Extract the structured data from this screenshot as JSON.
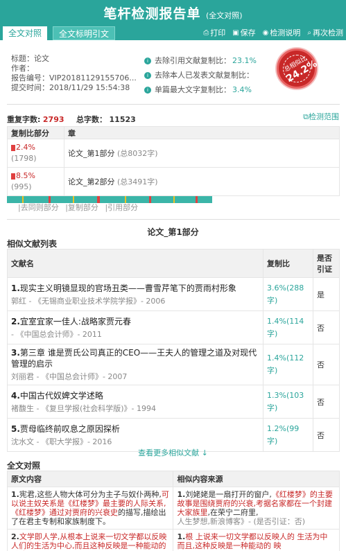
{
  "header": {
    "title": "笔杆检测报告单",
    "subtitle": "(全文对照)",
    "tabs": [
      {
        "label": "全文对照",
        "active": true
      },
      {
        "label": "全文标明引文",
        "active": false
      }
    ],
    "actions": [
      {
        "label": "打印",
        "icon": "printer-icon"
      },
      {
        "label": "保存",
        "icon": "save-icon"
      },
      {
        "label": "检测说明",
        "icon": "help-icon"
      },
      {
        "label": "再次检测",
        "icon": "search-icon"
      }
    ]
  },
  "info": {
    "title": "标题：论文",
    "author": "作者：",
    "report_no": "报告编号：VIP20181129155706...",
    "submit_time": "提交时间：2018/11/29 15:54:38"
  },
  "metrics": [
    {
      "label": "去除引用文献复制比：",
      "value": "23.1%"
    },
    {
      "label": "去除本人已发表文献复制比：",
      "value": ""
    },
    {
      "label": "单篇最大文字复制比：",
      "value": "3.4%"
    }
  ],
  "stamp": {
    "label": "总相似比",
    "value": "24.2%"
  },
  "counts": {
    "dup_label": "重复字数:",
    "dup_value": "2793",
    "total_label": "总字数：",
    "total_value": "11523",
    "range_link": "检测范围"
  },
  "parts": {
    "headers": [
      "复制比部分",
      "章"
    ],
    "rows": [
      {
        "pct": "2.4%",
        "count": "(1798)",
        "chapter": "论文_第1部分",
        "total": "(总8032字)"
      },
      {
        "pct": "8.5%",
        "count": "(995)",
        "chapter": "论文_第2部分",
        "total": "(总3491字)"
      }
    ]
  },
  "legend": [
    "|去同则部分",
    "|复制部分",
    "|引用部分"
  ],
  "section_title": "论文_第1部分",
  "similar_title": "相似文献列表",
  "docs": {
    "headers": [
      "文献名",
      "复制比",
      "是否引证"
    ],
    "rows": [
      {
        "num": "1.",
        "title": "现实主义明镜显现的官场丑类——曹雪芹笔下的贾雨村形象",
        "meta": "郭红 - 《无锡商业职业技术学院学报》- 2006",
        "ratio": "3.6%(288字)",
        "cite": "是"
      },
      {
        "num": "2.",
        "title": "宜室宜家一佳人:战略家贾元春",
        "meta": "- 《中国总会计师》- 2011",
        "ratio": "1.4%(114字)",
        "cite": "否"
      },
      {
        "num": "3.",
        "title": "第三章 谁是贾氏公司真正的CEO——王夫人的管理之道及对现代管理的启示",
        "meta": "刘丽君 - 《中国总会计师》- 2007",
        "ratio": "1.4%(112字)",
        "cite": "否"
      },
      {
        "num": "4.",
        "title": "中国古代奴婢文学述略",
        "meta": "褚馥生 - 《复旦学报(社会科学版)》- 1994",
        "ratio": "1.3%(103字)",
        "cite": "否"
      },
      {
        "num": "5.",
        "title": "贾母临终前叹息之原因探析",
        "meta": "沈水文 - 《职大学报》- 2016",
        "ratio": "1.2%(99字)",
        "cite": "否"
      }
    ]
  },
  "more_link": "查看更多相似文献 ↓",
  "fulltext": {
    "title": "全文对照",
    "headers": [
      "原文内容",
      "相似内容来源"
    ],
    "rows": [
      {
        "left_num": "1.",
        "left_normal_1": "宪君,这些人物大体可分为主子与奴仆两种,",
        "left_hl": "可以说主奴关系是《红楼梦》最主要的人际关系,《红楼梦》通过对贾府的兴衰史",
        "left_normal_2": "的描写,描绘出了在君主专制和家族制度下。",
        "right_num": "1.",
        "right_normal_1": "刘姥姥是一扇打开的窗户,",
        "right_hl": "《红楼梦》的主要故事是围绕贾府的兴衰,考据名家都在一个封建大家族里",
        "right_normal_2": ",在荣宁二府里,",
        "right_meta": "人生梦想,新浪博客》- (是否引证：否)"
      },
      {
        "left_num": "2.",
        "left_normal_1": "",
        "left_hl": "文学即人学,从根本上说来一切文学都以反映人们的生活为中心,而且这种反映是一种能动的反映",
        "left_normal_2": "",
        "right_num": "1.",
        "right_normal_1": "",
        "right_hl": "根 上说来一切文学都以反映人的 生活为中 而且,这种反映是一种能动的 映",
        "right_normal_2": "",
        "right_meta": ""
      }
    ]
  },
  "colors": {
    "accent": "#2aa59b",
    "stamp": "#c82828",
    "highlight": "#c82828"
  }
}
